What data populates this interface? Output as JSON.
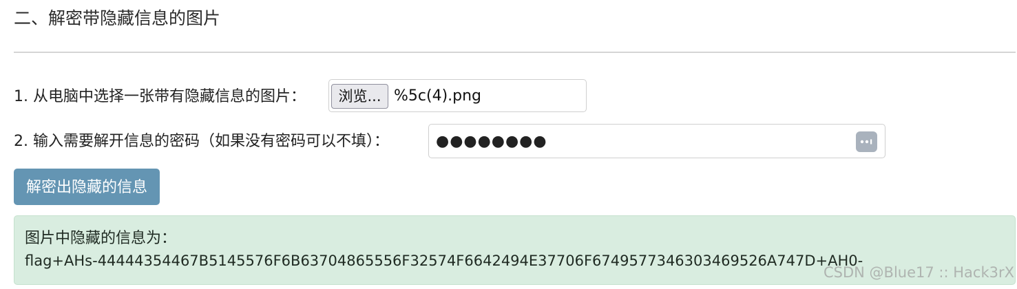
{
  "section": {
    "title": "二、解密带隐藏信息的图片"
  },
  "form": {
    "file_label": "1. 从电脑中选择一张带有隐藏信息的图片：",
    "browse_label": "浏览...",
    "file_name": "%5c(4).png",
    "password_label": "2. 输入需要解开信息的密码（如果没有密码可以不填）：",
    "password_value_masked": "●●●●●●●●",
    "password_icon": "password-manager-icon",
    "decrypt_button": "解密出隐藏的信息"
  },
  "result": {
    "label": "图片中隐藏的信息为：",
    "value": "flag+AHs-44444354467B5145576F6B63704865556F32574F6642494E37706F67495773463034695​26A747D+AH0-"
  },
  "watermark": "CSDN @Blue17 :: Hack3rX",
  "colors": {
    "primary_button": "#6495b3",
    "success_bg": "#d9ede0",
    "divider": "#d5d5d5"
  }
}
